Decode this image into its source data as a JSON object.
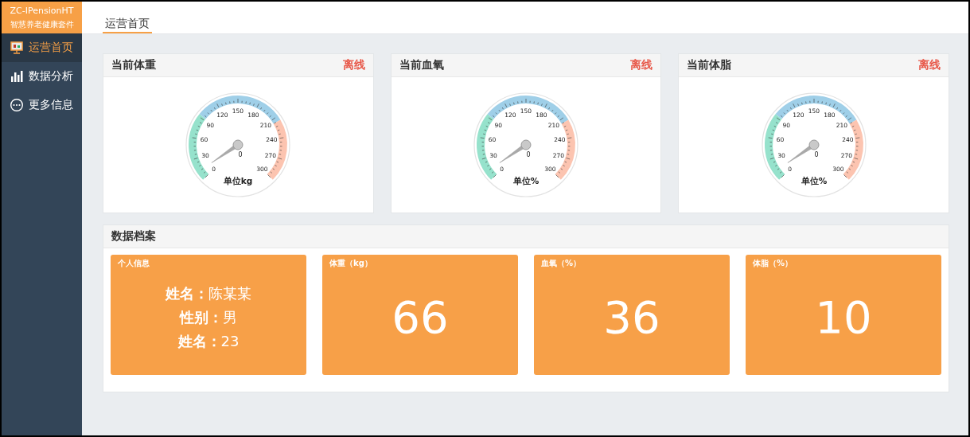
{
  "sidebar": {
    "brand": "ZC-IPensionHT",
    "subtitle": "智慧养老健康套件",
    "items": [
      {
        "label": "运营首页",
        "selected": true
      },
      {
        "label": "数据分析",
        "selected": false
      },
      {
        "label": "更多信息",
        "selected": false
      }
    ]
  },
  "tabs": [
    {
      "label": "运营首页",
      "selected": true
    }
  ],
  "gauges": [
    {
      "title": "当前体重",
      "status": "离线",
      "reading": "0",
      "unit": "单位kg",
      "ticks": [
        "0",
        "30",
        "60",
        "90",
        "120",
        "150",
        "180",
        "210",
        "240",
        "270",
        "300"
      ]
    },
    {
      "title": "当前血氧",
      "status": "离线",
      "reading": "0",
      "unit": "单位%",
      "ticks": [
        "0",
        "30",
        "60",
        "90",
        "120",
        "150",
        "180",
        "210",
        "240",
        "270",
        "300"
      ]
    },
    {
      "title": "当前体脂",
      "status": "离线",
      "reading": "0",
      "unit": "单位%",
      "ticks": [
        "0",
        "30",
        "60",
        "90",
        "120",
        "150",
        "180",
        "210",
        "240",
        "270",
        "300"
      ]
    }
  ],
  "records": {
    "title": "数据档案",
    "tiles": [
      {
        "kind": "info",
        "title": "个人信息",
        "lines": [
          {
            "label": "姓名：",
            "value": "陈某某"
          },
          {
            "label": "性别：",
            "value": "男"
          },
          {
            "label": "姓名：",
            "value": "23"
          }
        ]
      },
      {
        "kind": "value",
        "title": "体重（kg）",
        "value": "66"
      },
      {
        "kind": "value",
        "title": "血氧（%）",
        "value": "36"
      },
      {
        "kind": "value",
        "title": "体脂（%）",
        "value": "10"
      }
    ]
  }
}
